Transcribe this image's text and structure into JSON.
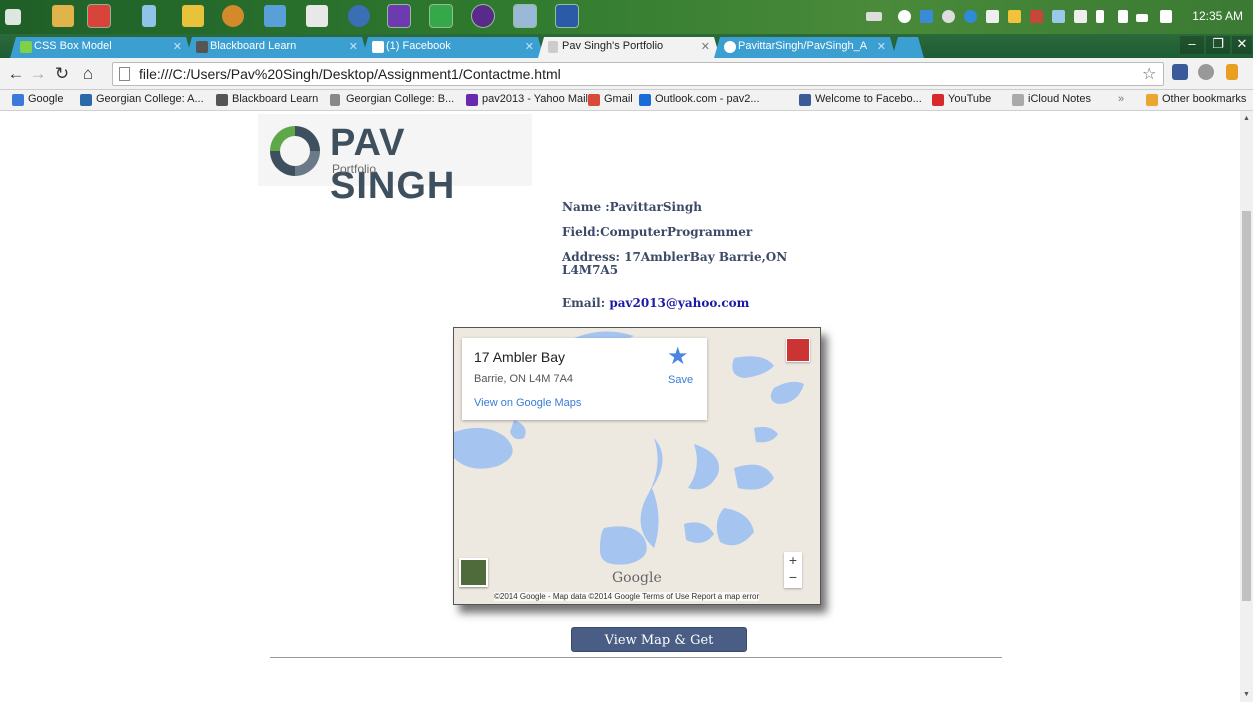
{
  "taskbar": {
    "clock": "12:35 AM"
  },
  "tabs": [
    {
      "label": "CSS Box Model"
    },
    {
      "label": "Blackboard Learn"
    },
    {
      "label": "(1) Facebook"
    },
    {
      "label": "Pav Singh's Portfolio"
    },
    {
      "label": "PavittarSingh/PavSingh_A"
    }
  ],
  "address_bar": {
    "url": "file:///C:/Users/Pav%20Singh/Desktop/Assignment1/Contactme.html"
  },
  "bookmarks": [
    {
      "label": "Google"
    },
    {
      "label": "Georgian College: A..."
    },
    {
      "label": "Blackboard Learn"
    },
    {
      "label": "Georgian College: B..."
    },
    {
      "label": "pav2013 - Yahoo Mail"
    },
    {
      "label": "Gmail"
    },
    {
      "label": "Outlook.com - pav2..."
    },
    {
      "label": "Welcome to Facebo..."
    },
    {
      "label": "YouTube"
    },
    {
      "label": "iCloud Notes"
    },
    {
      "label": "»"
    },
    {
      "label": "Other bookmarks"
    }
  ],
  "logo": {
    "title": "PAV SINGH",
    "subtitle": "Portfolio"
  },
  "contact": {
    "name": "Name :PavittarSingh",
    "field": "Field:ComputerProgrammer",
    "address_line1": "Address: 17AmblerBay Barrie,ON",
    "address_line2": "L4M7A5",
    "email_label": "Email:",
    "email": "pav2013@yahoo.com"
  },
  "map": {
    "place_name": "17 Ambler Bay",
    "place_address": "Barrie, ON L4M 7A4",
    "view_link": "View on Google Maps",
    "save_label": "Save",
    "google_mark": "Google",
    "attribution": "©2014 Google - Map data ©2014 Google    Terms of Use    Report a map error",
    "zoom_in": "+",
    "zoom_out": "−"
  },
  "directions_button": "View Map & Get Directions",
  "colors": {
    "tab_blue": "#3b9fd1",
    "button": "#4a5e85",
    "contact_text": "#3b4a67",
    "email_link": "#1a1aa8"
  }
}
